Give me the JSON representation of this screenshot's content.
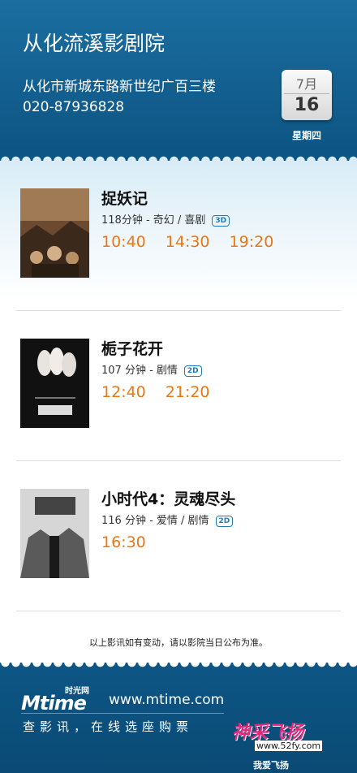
{
  "cinema": {
    "name": "从化流溪影剧院",
    "address": "从化市新城东路新世纪广百三楼",
    "phone": "020-87936828"
  },
  "date": {
    "month": "7月",
    "day": "16",
    "weekday": "星期四"
  },
  "movies": [
    {
      "title": "捉妖记",
      "meta": "118分钟 - 奇幻 / 喜剧",
      "format": "3D",
      "times": [
        "10:40",
        "14:30",
        "19:20"
      ]
    },
    {
      "title": "栀子花开",
      "meta": "107 分钟 - 剧情",
      "format": "2D",
      "times": [
        "12:40",
        "21:20"
      ]
    },
    {
      "title": "小时代4：灵魂尽头",
      "meta": "116 分钟 - 爱情 / 剧情",
      "format": "2D",
      "times": [
        "16:30"
      ]
    }
  ],
  "notice": "以上影讯如有变动，请以影院当日公布为准。",
  "footer": {
    "logo_cn": "时光网",
    "logo_text": "Mtime",
    "site_url": "www.mtime.com",
    "slogan": "查影讯，在线选座购票"
  },
  "watermark": {
    "title": "神采飞扬",
    "url": "www.52fy.com",
    "subtitle": "我爱飞扬"
  },
  "colors": {
    "header_blue": "#0d5584",
    "showtime_orange": "#e77817",
    "format_badge": "#1e7cb2"
  }
}
